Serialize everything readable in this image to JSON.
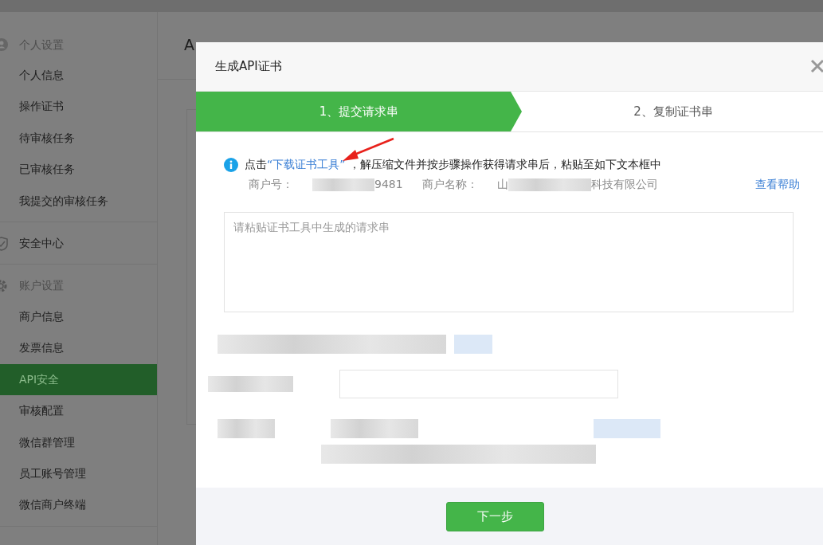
{
  "sidebar": {
    "groups": [
      {
        "title": "个人设置",
        "items": [
          {
            "label": "个人信息",
            "selected": false
          },
          {
            "label": "操作证书",
            "selected": false
          },
          {
            "label": "待审核任务",
            "selected": false
          },
          {
            "label": "已审核任务",
            "selected": false
          },
          {
            "label": "我提交的审核任务",
            "selected": false
          }
        ]
      },
      {
        "title": "安全中心"
      },
      {
        "title": "账户设置",
        "items": [
          {
            "label": "商户信息",
            "selected": false
          },
          {
            "label": "发票信息",
            "selected": false
          },
          {
            "label": "API安全",
            "selected": true
          },
          {
            "label": "审核配置",
            "selected": false
          },
          {
            "label": "微信群管理",
            "selected": false
          },
          {
            "label": "员工账号管理",
            "selected": false
          },
          {
            "label": "微信商户终端",
            "selected": false
          }
        ]
      }
    ]
  },
  "page": {
    "title": "A"
  },
  "modal": {
    "title": "生成API证书",
    "steps": [
      {
        "label": "1、提交请求串",
        "selected": true
      },
      {
        "label": "2、复制证书串",
        "selected": false
      }
    ],
    "info": {
      "before": "点击",
      "link": "“下载证书工具”",
      "after": "，解压缩文件并按步骤操作获得请求串后，粘贴至如下文本框中"
    },
    "merchant": {
      "id_label": "商户号：",
      "id_tail": "9481",
      "name_label": "商户名称：",
      "name_start": "山",
      "name_end": "科技有限公司",
      "help": "查看帮助"
    },
    "request": {
      "placeholder": "请粘贴证书工具中生成的请求串"
    },
    "next_button": "下一步"
  }
}
